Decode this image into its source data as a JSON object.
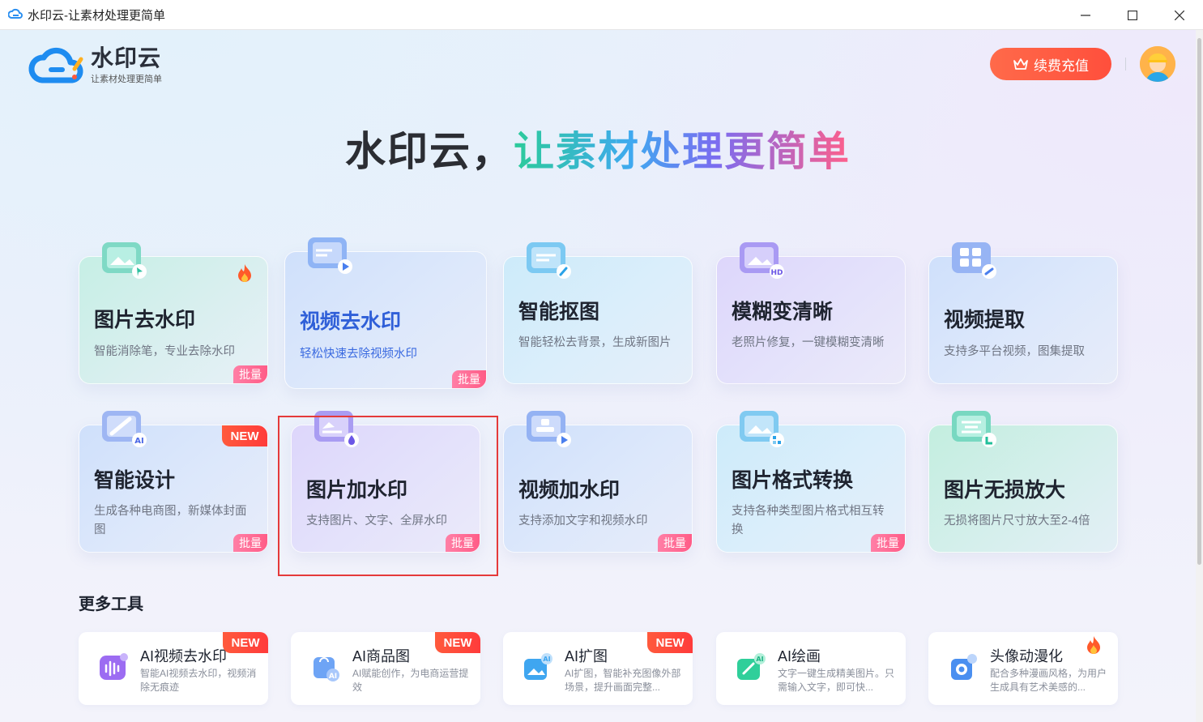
{
  "window": {
    "title": "水印云-让素材处理更简单"
  },
  "logo": {
    "name": "水印云",
    "slogan": "让素材处理更简单"
  },
  "header": {
    "vip_button_label": "续费充值"
  },
  "headline": {
    "part1": "水印云，",
    "part2": "让素材处理更简单"
  },
  "cards": [
    {
      "title": "图片去水印",
      "desc": "智能消除笔，专业去除水印",
      "icon": "image-eraser-icon",
      "badge_top": "fire",
      "badge_bottom": "批量"
    },
    {
      "title": "视频去水印",
      "desc": "轻松快速去除视频水印",
      "icon": "video-eraser-icon",
      "badge_top": "",
      "badge_bottom": "批量"
    },
    {
      "title": "智能抠图",
      "desc": "智能轻松去背景，生成新图片",
      "icon": "cutout-icon",
      "badge_top": "",
      "badge_bottom": ""
    },
    {
      "title": "模糊变清晰",
      "desc": "老照片修复，一键模糊变清晰",
      "icon": "hd-enhance-icon",
      "badge_top": "",
      "badge_bottom": ""
    },
    {
      "title": "视频提取",
      "desc": "支持多平台视频，图集提取",
      "icon": "video-extract-icon",
      "badge_top": "",
      "badge_bottom": ""
    },
    {
      "title": "智能设计",
      "desc": "生成各种电商图，新媒体封面图",
      "icon": "ai-design-icon",
      "badge_top": "NEW",
      "badge_bottom": "批量"
    },
    {
      "title": "图片加水印",
      "desc": "支持图片、文字、全屏水印",
      "icon": "image-watermark-icon",
      "badge_top": "",
      "badge_bottom": "批量"
    },
    {
      "title": "视频加水印",
      "desc": "支持添加文字和视频水印",
      "icon": "video-watermark-icon",
      "badge_top": "",
      "badge_bottom": "批量"
    },
    {
      "title": "图片格式转换",
      "desc": "支持各种类型图片格式相互转换",
      "icon": "format-convert-icon",
      "badge_top": "",
      "badge_bottom": "批量"
    },
    {
      "title": "图片无损放大",
      "desc": "无损将图片尺寸放大至2-4倍",
      "icon": "upscale-icon",
      "badge_top": "",
      "badge_bottom": ""
    }
  ],
  "more_tools": {
    "title": "更多工具",
    "items": [
      {
        "title": "AI视频去水印",
        "desc": "智能AI视频去水印，视频消除无痕迹",
        "icon": "ai-video-icon",
        "badge": "NEW"
      },
      {
        "title": "AI商品图",
        "desc": "AI赋能创作，为电商运营提效",
        "icon": "ai-product-icon",
        "badge": "NEW"
      },
      {
        "title": "AI扩图",
        "desc": "AI扩图，智能补充图像外部场景，提升画面完整...",
        "icon": "ai-expand-icon",
        "badge": "NEW"
      },
      {
        "title": "AI绘画",
        "desc": "文字一键生成精美图片。只需输入文字，即可快...",
        "icon": "ai-paint-icon",
        "badge": ""
      },
      {
        "title": "头像动漫化",
        "desc": "配合多种漫画风格，为用户生成具有艺术美感的...",
        "icon": "avatar-anime-icon",
        "badge": "fire"
      }
    ]
  },
  "colors": {
    "accent_red": "#ff5a3c",
    "batch_pink": "#ff5c87",
    "highlight_border": "#e53a3a"
  }
}
